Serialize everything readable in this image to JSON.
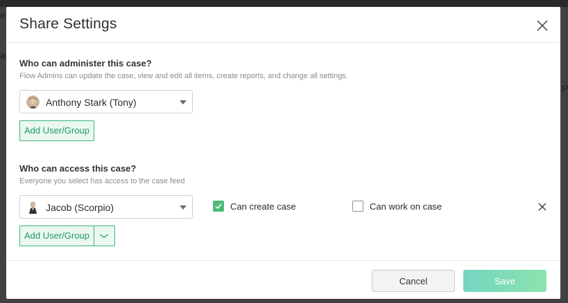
{
  "background": {
    "fragment_left_1": "e",
    "fragment_left_2": "a",
    "fragment_right_1": "P"
  },
  "modal": {
    "title": "Share Settings",
    "close_icon": "close-icon"
  },
  "admin_section": {
    "title": "Who can administer this case?",
    "description": "Flow Admins can update the case, view and edit all items, create reports, and change all settings.",
    "selected_user": "Anthony Stark (Tony)",
    "add_button_label": "Add User/Group"
  },
  "access_section": {
    "title": "Who can access this case?",
    "description": "Everyone you select has access to the case feed",
    "selected_user": "Jacob (Scorpio)",
    "can_create_label": "Can create case",
    "can_create_checked": true,
    "can_work_label": "Can work on case",
    "can_work_checked": false,
    "add_button_label": "Add User/Group",
    "dropdown_icon": "chevron-down-icon",
    "remove_icon": "close-icon"
  },
  "footer": {
    "cancel_label": "Cancel",
    "save_label": "Save"
  },
  "colors": {
    "accent_green": "#3bb37a",
    "checkbox_green": "#4cba78",
    "save_gradient_start": "#66d1bb",
    "save_gradient_end": "#7fe0a4"
  }
}
